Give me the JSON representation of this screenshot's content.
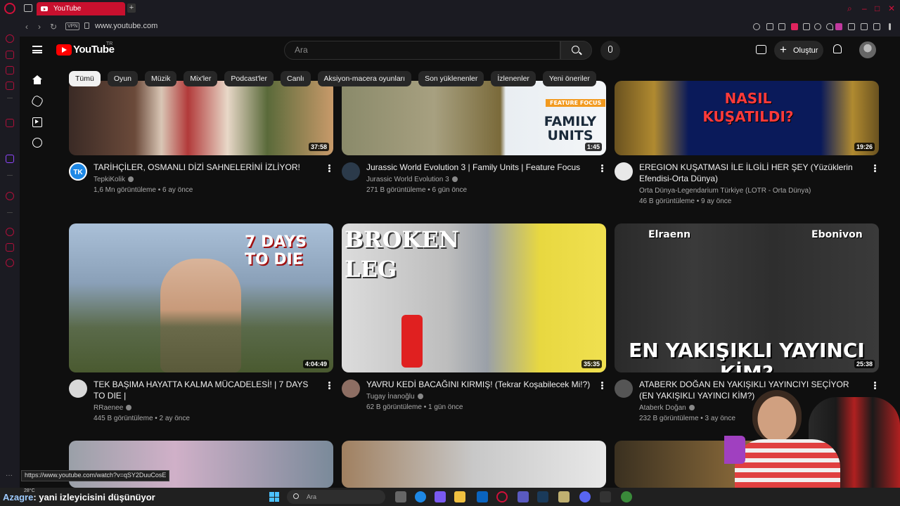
{
  "browser": {
    "tab_title": "YouTube",
    "new_tab": "+",
    "vpn_label": "VPN",
    "url": "www.youtube.com",
    "window_controls": [
      "⌕",
      "–",
      "□",
      "✕"
    ]
  },
  "youtube": {
    "wordmark": "YouTube",
    "region": "TR",
    "search_placeholder": "Ara",
    "create_label": "Oluştur",
    "chips": [
      "Tümü",
      "Oyun",
      "Müzik",
      "Mix'ler",
      "Podcast'ler",
      "Canlı",
      "Aksiyon-macera oyunları",
      "Son yüklenenler",
      "İzlenenler",
      "Yeni öneriler"
    ],
    "active_chip": "Tümü"
  },
  "videos": [
    {
      "title": "TARİHÇİLER, OSMANLI DİZİ SAHNELERİNİ İZLİYOR!",
      "channel": "TepkiKolik",
      "meta": "1,6 Mn görüntüleme • 6 ay önce",
      "duration": "37:58",
      "avatar_text": "TK",
      "avatar_color": "#1e88e5"
    },
    {
      "title": "Jurassic World Evolution 3 | Family Units | Feature Focus",
      "channel": "Jurassic World Evolution 3",
      "meta": "271 B görüntüleme • 6 gün önce",
      "duration": "1:45",
      "thumb_tag": "FEATURE FOCUS",
      "thumb_text": "FAMILY UNITS",
      "avatar_color": "#2b3a4a"
    },
    {
      "title": "EREGION KUŞATMASI İLE İLGİLİ HER ŞEY (Yüzüklerin Efendisi-Orta Dünya)",
      "channel": "Orta Dünya-Legendarium Türkiye (LOTR - Orta Dünya)",
      "meta": "46 B görüntüleme • 9 ay önce",
      "duration": "19:26",
      "thumb_text": "NASIL KUŞATILDI?",
      "avatar_color": "#e8e8e8"
    },
    {
      "title": "TEK BAŞIMA HAYATTA KALMA MÜCADELESİ! | 7 DAYS TO DIE |",
      "channel": "RRaenee",
      "meta": "445 B görüntüleme • 2 ay önce",
      "duration": "4:04:49",
      "thumb_text": "7 DAYS TO DIE",
      "avatar_color": "#d8d8d8"
    },
    {
      "title": "YAVRU KEDİ BACAĞINI KIRMIŞ! (Tekrar Koşabilecek Mi!?)",
      "channel": "Tugay İnanoğlu",
      "meta": "62 B görüntüleme • 1 gün önce",
      "duration": "35:35",
      "thumb_text": "BROKEN LEG",
      "avatar_color": "#8d6e63"
    },
    {
      "title": "ATABERK DOĞAN EN YAKIŞIKLI YAYINCIYI SEÇİYOR (EN YAKIŞIKLI YAYINCI KİM?)",
      "channel": "Ataberk Doğan",
      "meta": "232 B görüntüleme • 3 ay önce",
      "duration": "25:38",
      "thumb_text": "EN YAKIŞIKLI YAYINCI KİM?",
      "thumb_names": [
        "Elraenn",
        "Ebonivon"
      ],
      "avatar_color": "#555555"
    }
  ],
  "status_url": "https://www.youtube.com/watch?v=qSY2DuuCosE",
  "taskbar": {
    "weather": "28°C",
    "chat_user": "Azagre",
    "chat_message": ": yani izleyicisini düşünüyor",
    "search_placeholder": "Ara"
  }
}
